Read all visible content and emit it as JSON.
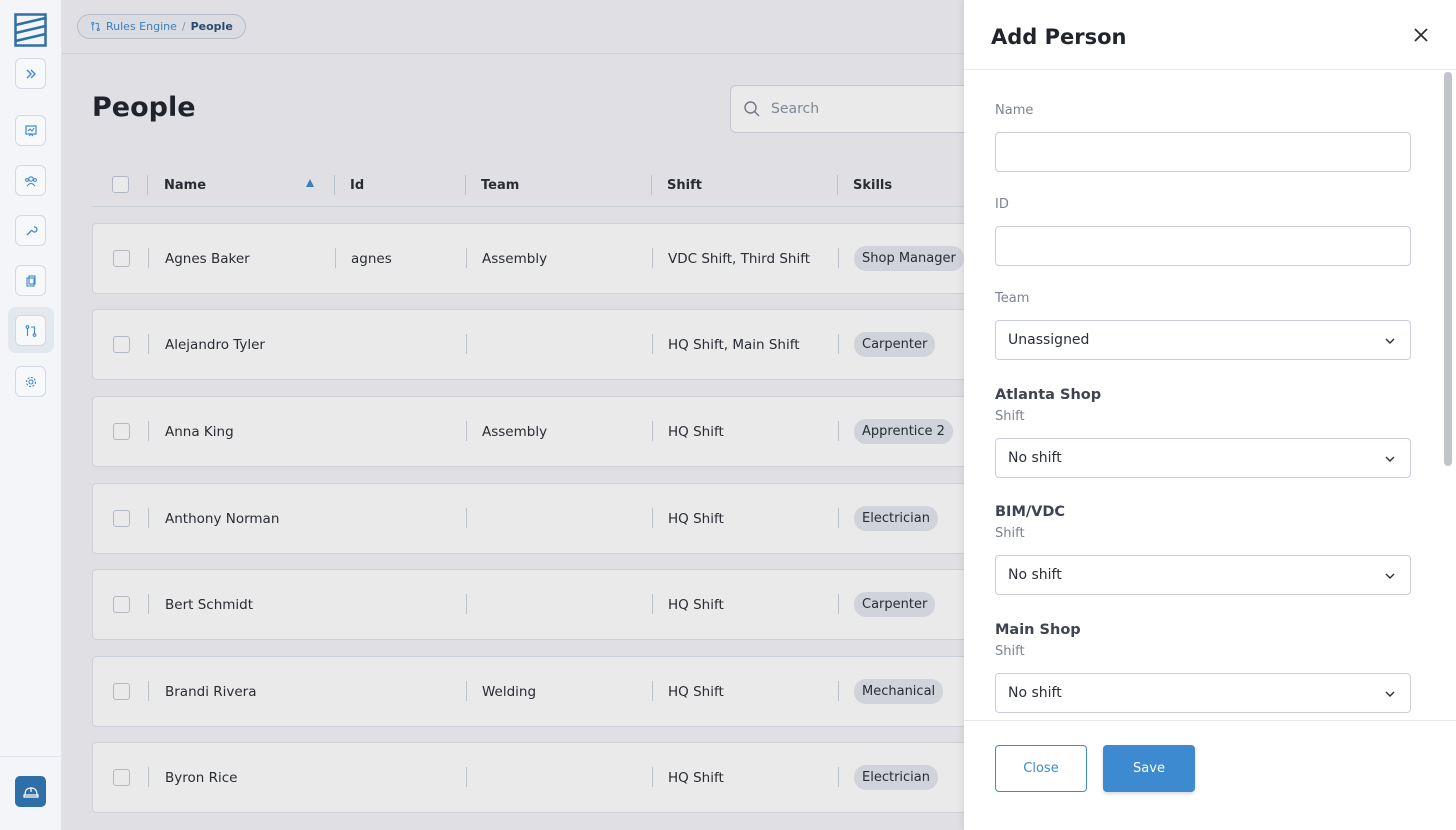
{
  "breadcrumb": {
    "parent": "Rules Engine",
    "separator": "/",
    "current": "People"
  },
  "page": {
    "title": "People"
  },
  "search": {
    "placeholder": "Search"
  },
  "table": {
    "columns": {
      "name": "Name",
      "id": "Id",
      "team": "Team",
      "shift": "Shift",
      "skills": "Skills"
    },
    "rows": [
      {
        "name": "Agnes Baker",
        "id": "agnes",
        "team": "Assembly",
        "shift": "VDC Shift, Third Shift",
        "skill": "Shop Manager"
      },
      {
        "name": "Alejandro Tyler",
        "id": "",
        "team": "",
        "shift": "HQ Shift, Main Shift",
        "skill": "Carpenter"
      },
      {
        "name": "Anna King",
        "id": "",
        "team": "Assembly",
        "shift": "HQ Shift",
        "skill": "Apprentice 2"
      },
      {
        "name": "Anthony Norman",
        "id": "",
        "team": "",
        "shift": "HQ Shift",
        "skill": "Electrician"
      },
      {
        "name": "Bert Schmidt",
        "id": "",
        "team": "",
        "shift": "HQ Shift",
        "skill": "Carpenter"
      },
      {
        "name": "Brandi Rivera",
        "id": "",
        "team": "Welding",
        "shift": "HQ Shift",
        "skill": "Mechanical"
      },
      {
        "name": "Byron Rice",
        "id": "",
        "team": "",
        "shift": "HQ Shift",
        "skill": "Electrician"
      }
    ]
  },
  "drawer": {
    "title": "Add Person",
    "fields": {
      "name_label": "Name",
      "id_label": "ID",
      "team_label": "Team",
      "team_value": "Unassigned"
    },
    "sections": [
      {
        "title": "Atlanta Shop",
        "label": "Shift",
        "value": "No shift"
      },
      {
        "title": "BIM/VDC",
        "label": "Shift",
        "value": "No shift"
      },
      {
        "title": "Main Shop",
        "label": "Shift",
        "value": "No shift"
      }
    ],
    "close_label": "Close",
    "save_label": "Save"
  },
  "colors": {
    "accent": "#3d8ad1",
    "sidebar_active": "#2f6fa7"
  },
  "icons": [
    "logo-icon",
    "expand-icon",
    "presentation-icon",
    "people-icon",
    "wrench-icon",
    "clipboard-icon",
    "rules-icon",
    "gear-icon",
    "hardhat-icon",
    "search-icon",
    "close-icon",
    "chevron-down-icon"
  ]
}
